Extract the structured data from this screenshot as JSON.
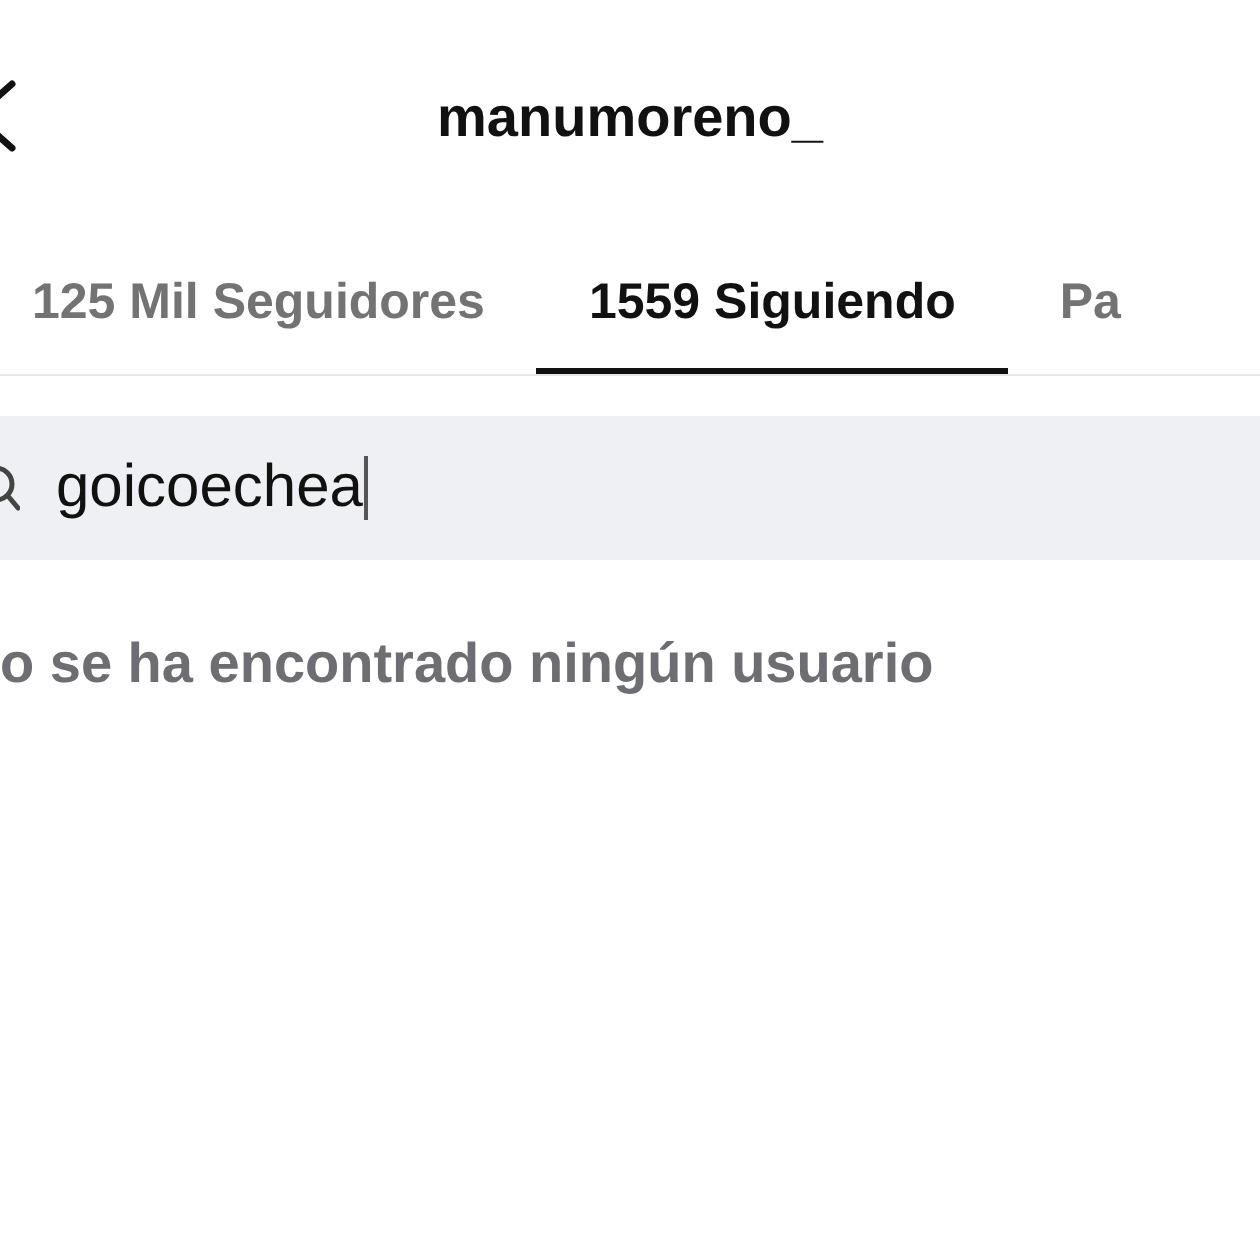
{
  "header": {
    "title": "manumoreno_"
  },
  "tabs": [
    {
      "label": "125 Mil Seguidores",
      "selected": false
    },
    {
      "label": "1559 Siguiendo",
      "selected": true
    },
    {
      "label": "Pa",
      "selected": false
    }
  ],
  "search": {
    "value": "goicoechea"
  },
  "message": "o se ha encontrado ningún usuario"
}
